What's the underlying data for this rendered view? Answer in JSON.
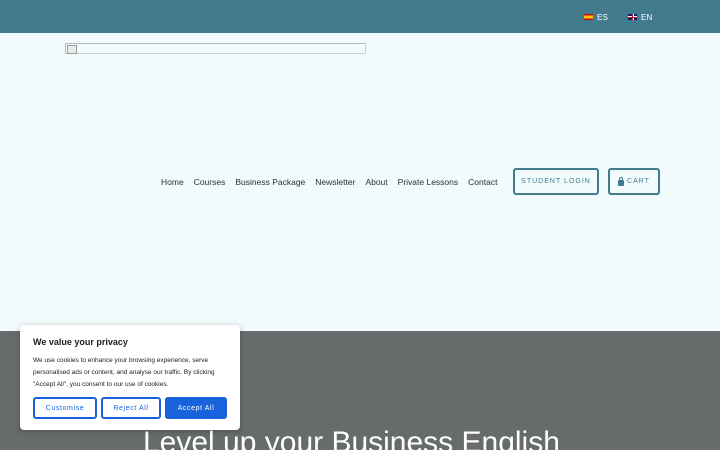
{
  "topbar": {
    "languages": [
      {
        "code": "ES",
        "flag": "spain-flag-icon"
      },
      {
        "code": "EN",
        "flag": "uk-flag-icon"
      }
    ],
    "background": "#437b8e"
  },
  "nav": {
    "items": [
      "Home",
      "Courses",
      "Business Package",
      "Newsletter",
      "About",
      "Private Lessons",
      "Contact"
    ],
    "student_login": "STUDENT LOGIN",
    "cart": "CART",
    "cart_icon": "shopping-bag-icon"
  },
  "hero": {
    "title": "Level up your Business English",
    "background": "#676b6c"
  },
  "cookie_banner": {
    "title": "We value your privacy",
    "text": "We use cookies to enhance your browsing experience, serve personalised ads or content, and analyse our traffic. By clicking \"Accept All\", you consent to our use of cookies.",
    "customise": "Customise",
    "reject": "Reject All",
    "accept": "Accept All",
    "accent": "#1863dc"
  }
}
